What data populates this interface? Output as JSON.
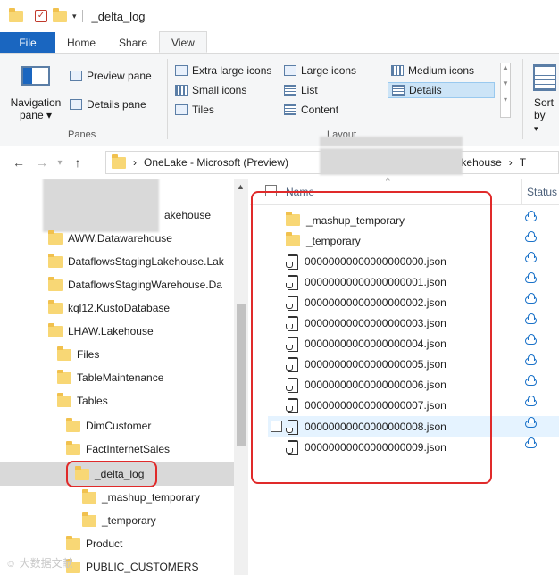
{
  "titlebar": {
    "title": "_delta_log",
    "quick_access_dropdown": "▾"
  },
  "ribbon_tabs": [
    {
      "label": "File"
    },
    {
      "label": "Home"
    },
    {
      "label": "Share"
    },
    {
      "label": "View"
    }
  ],
  "ribbon": {
    "panes_group": {
      "navigation_pane_label": "Navigation pane",
      "navigation_pane_arrow": "▾",
      "preview_pane": "Preview pane",
      "details_pane": "Details pane",
      "group_label": "Panes"
    },
    "layout_group": {
      "extra_large_icons": "Extra large icons",
      "large_icons": "Large icons",
      "medium_icons": "Medium icons",
      "small_icons": "Small icons",
      "list": "List",
      "details": "Details",
      "tiles": "Tiles",
      "content": "Content",
      "group_label": "Layout",
      "selected": "Details"
    },
    "sort_by": "Sort by",
    "sort_by_arrow": "▾"
  },
  "addressbar": {
    "back": "←",
    "forward": "→",
    "recent": "▾",
    "up": "↑",
    "sep": "›",
    "crumb_root": "OneLake - Microsoft (Preview)",
    "crumb_lakehouse": "W.Lakehouse",
    "crumb_next": "T"
  },
  "navtree": {
    "items": [
      {
        "label": "akehouse"
      },
      {
        "label": "AWW.Datawarehouse"
      },
      {
        "label": "DataflowsStagingLakehouse.Lak"
      },
      {
        "label": "DataflowsStagingWarehouse.Da"
      },
      {
        "label": "kql12.KustoDatabase"
      },
      {
        "label": "LHAW.Lakehouse"
      },
      {
        "label": "Files"
      },
      {
        "label": "TableMaintenance"
      },
      {
        "label": "Tables"
      },
      {
        "label": "DimCustomer"
      },
      {
        "label": "FactInternetSales"
      },
      {
        "label": "_delta_log"
      },
      {
        "label": "_mashup_temporary"
      },
      {
        "label": "_temporary"
      },
      {
        "label": "Product"
      },
      {
        "label": "PUBLIC_CUSTOMERS"
      }
    ]
  },
  "filelist": {
    "col_name": "Name",
    "col_status": "Status",
    "sort_indicator": "^",
    "items": [
      {
        "name": "_mashup_temporary",
        "type": "folder"
      },
      {
        "name": "_temporary",
        "type": "folder"
      },
      {
        "name": "00000000000000000000.json",
        "type": "file"
      },
      {
        "name": "00000000000000000001.json",
        "type": "file"
      },
      {
        "name": "00000000000000000002.json",
        "type": "file"
      },
      {
        "name": "00000000000000000003.json",
        "type": "file"
      },
      {
        "name": "00000000000000000004.json",
        "type": "file"
      },
      {
        "name": "00000000000000000005.json",
        "type": "file"
      },
      {
        "name": "00000000000000000006.json",
        "type": "file"
      },
      {
        "name": "00000000000000000007.json",
        "type": "file"
      },
      {
        "name": "00000000000000000008.json",
        "type": "file"
      },
      {
        "name": "00000000000000000009.json",
        "type": "file"
      }
    ]
  },
  "colors": {
    "file_tab": "#1a66c0",
    "highlight_box": "#e02a2a",
    "folder": "#f8d775",
    "cloud_status": "#1a72c9",
    "selected_tree": "#d9d9d9",
    "hover_row": "#e5f3ff"
  },
  "watermark": "☺ 大数据文献"
}
